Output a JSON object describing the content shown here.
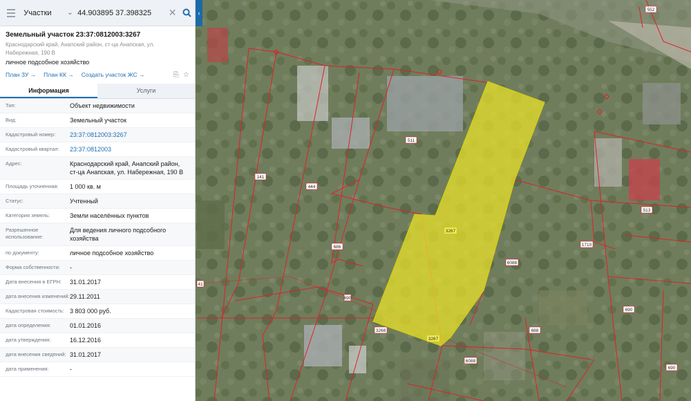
{
  "search": {
    "layer": "Участки",
    "query": "44.903895 37.398325"
  },
  "object": {
    "title": "Земельный участок 23:37:0812003:3267",
    "address": "Краснодарский край, Анапский район, ст-ца Анапская, ул. Набережная, 190 В",
    "usage": "личное подсобное хозяйство",
    "links": [
      "План ЗУ →",
      "План КК →",
      "Создать участок ЖС →"
    ]
  },
  "tabs": [
    "Информация",
    "Услуги"
  ],
  "properties": [
    {
      "key": "Тип:",
      "value": "Объект недвижимости"
    },
    {
      "key": "Вид:",
      "value": "Земельный участок"
    },
    {
      "key": "Кадастровый номер:",
      "value": "23:37:0812003:3267",
      "link": true
    },
    {
      "key": "Кадастровый квартал:",
      "value": "23:37:0812003",
      "link": true
    },
    {
      "key": "Адрес:",
      "value": "Краснодарский край, Анапский район, ст-ца Анапская, ул. Набережная, 190 В"
    },
    {
      "key": "Площадь уточненная:",
      "value": "1 000 кв. м"
    },
    {
      "key": "Статус:",
      "value": "Учтенный"
    },
    {
      "key": "Категория земель:",
      "value": "Земли населённых пунктов"
    },
    {
      "key": "Разрешенное использование:",
      "value": "Для ведения личного подсобного хозяйства"
    },
    {
      "key": "по документу:",
      "value": "личное подсобное хозяйство"
    },
    {
      "key": "Форма собственности:",
      "value": "-"
    },
    {
      "key": "Дата внесения в ЕГРН:",
      "value": "31.01.2017"
    },
    {
      "key": "дата внесения изменений:",
      "value": "29.11.2011"
    },
    {
      "key": "Кадастровая стоимость:",
      "value": "3 803 000 руб."
    },
    {
      "key": "дата определения:",
      "value": "01.01.2016"
    },
    {
      "key": "дата утверждения:",
      "value": "16.12.2016"
    },
    {
      "key": "дата внесения сведений:",
      "value": "31.01.2017"
    },
    {
      "key": "дата применения:",
      "value": "-"
    }
  ],
  "map": {
    "parcel_labels": [
      "552",
      "511",
      "141",
      "444",
      "686",
      "3267",
      "6088",
      "513",
      "1710",
      "690",
      "688",
      "3268",
      "6088",
      "690",
      "41",
      "690",
      "696"
    ],
    "colors": {
      "highlight": "#e8e22a",
      "boundary": "#e0202a",
      "accent": "#1f6fb2"
    }
  }
}
